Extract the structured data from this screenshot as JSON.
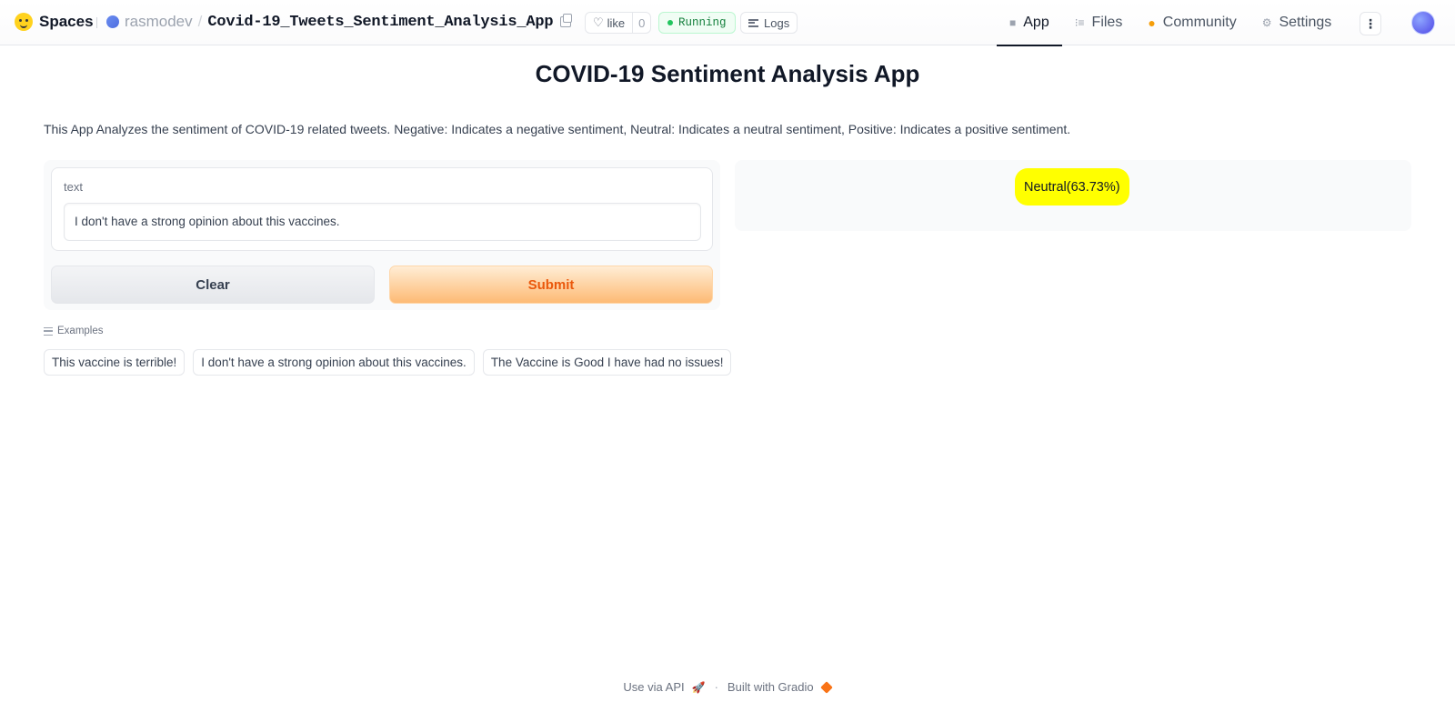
{
  "header": {
    "brand": "Spaces",
    "owner": "rasmodev",
    "separator": "/",
    "repo_name": "Covid-19_Tweets_Sentiment_Analysis_App",
    "like_label": "like",
    "like_count": "0",
    "status": "Running",
    "logs_label": "Logs",
    "nav": [
      {
        "label": "App",
        "icon": "cube-icon"
      },
      {
        "label": "Files",
        "icon": "files-icon"
      },
      {
        "label": "Community",
        "icon": "community-icon"
      },
      {
        "label": "Settings",
        "icon": "gear-icon"
      }
    ],
    "more_label": "⋮"
  },
  "main": {
    "title": "COVID-19 Sentiment Analysis App",
    "description": "This App Analyzes the sentiment of COVID-19 related tweets. Negative: Indicates a negative sentiment, Neutral: Indicates a neutral sentiment, Positive: Indicates a positive sentiment.",
    "input": {
      "label": "text",
      "value": "I don't have a strong opinion about this vaccines."
    },
    "buttons": {
      "clear": "Clear",
      "submit": "Submit"
    },
    "examples": {
      "heading": "Examples",
      "items": [
        "This vaccine is terrible!",
        "I don't have a strong opinion about this vaccines.",
        "The Vaccine is Good I have had no issues!"
      ]
    },
    "output": {
      "label": "Neutral(63.73%)",
      "color": "#ffff00"
    }
  },
  "footer": {
    "api": "Use via API",
    "dot": "·",
    "built": "Built with Gradio"
  },
  "colors": {
    "accent": "#ea580c",
    "status": "#15803d"
  }
}
